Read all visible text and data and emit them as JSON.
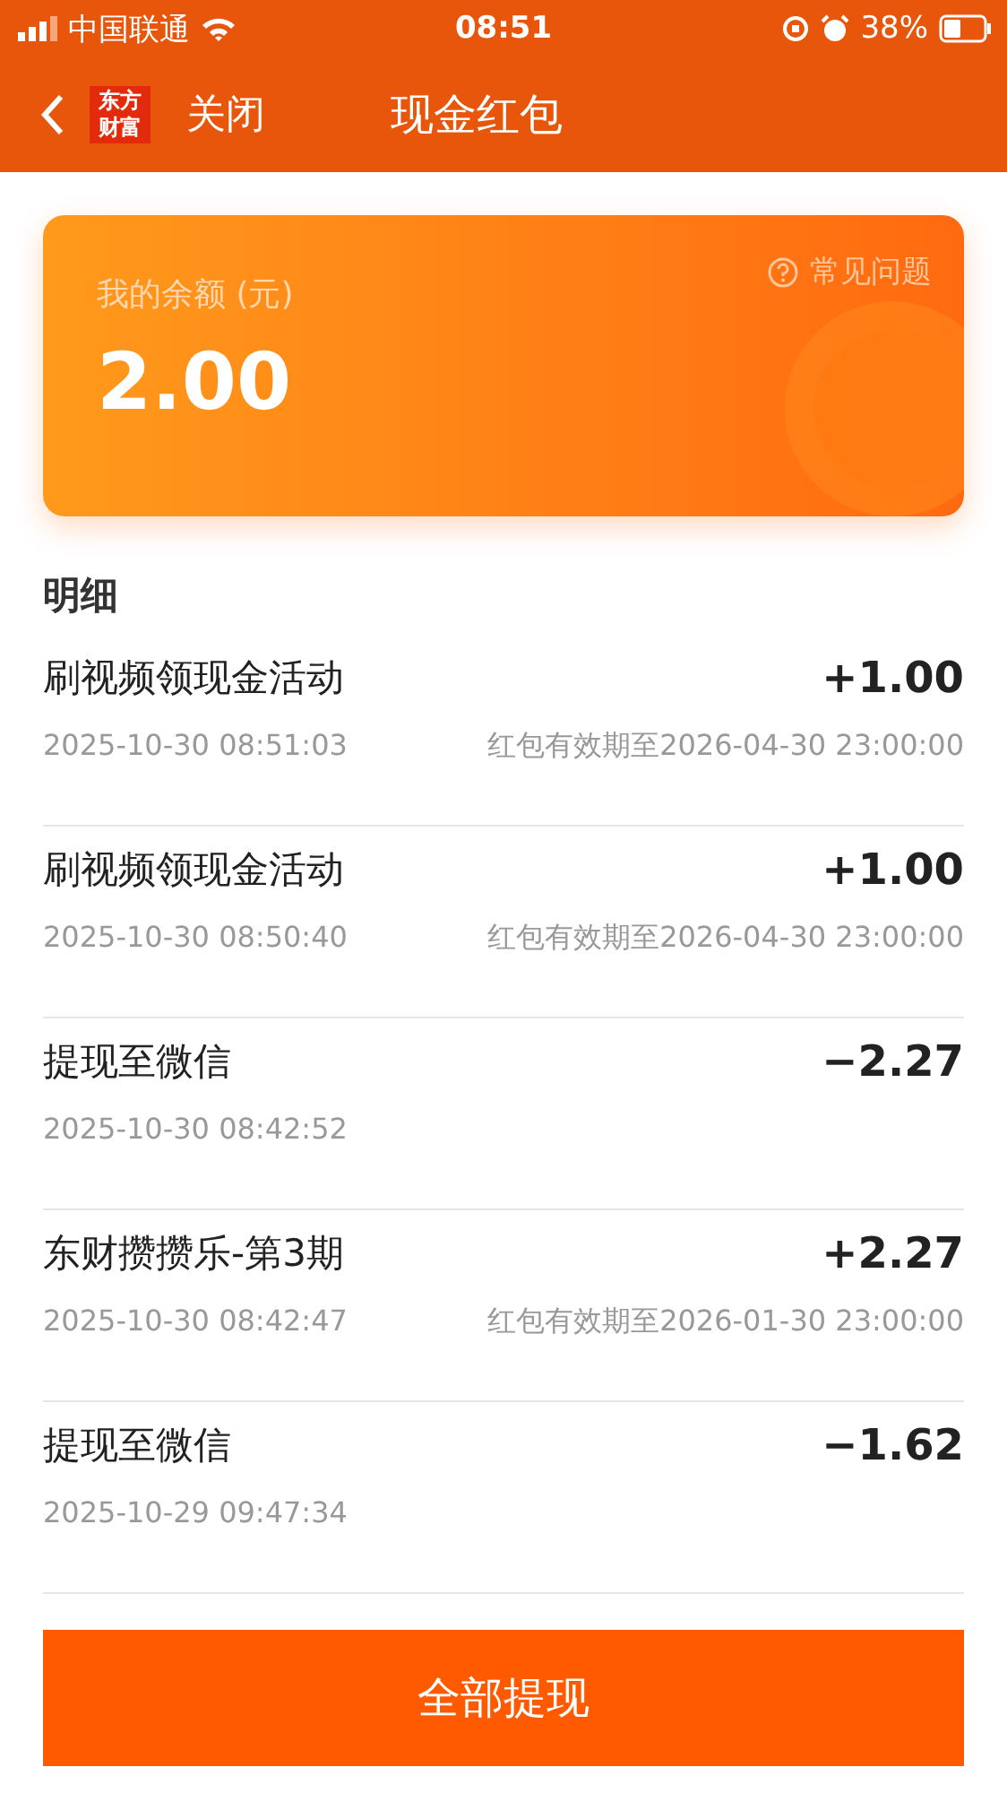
{
  "status_bar": {
    "carrier": "中国联通",
    "time": "08:51",
    "battery": "38%"
  },
  "nav": {
    "logo": "东方财富",
    "close": "关闭",
    "title": "现金红包"
  },
  "balance_card": {
    "label": "我的余额 (元)",
    "amount": "2.00",
    "help": "常见问题"
  },
  "section_title": "明细",
  "records": [
    {
      "title": "刷视频领现金活动",
      "amount": "+1.00",
      "date": "2025-10-30 08:51:03",
      "validity": "红包有效期至2026-04-30 23:00:00"
    },
    {
      "title": "刷视频领现金活动",
      "amount": "+1.00",
      "date": "2025-10-30 08:50:40",
      "validity": "红包有效期至2026-04-30 23:00:00"
    },
    {
      "title": "提现至微信",
      "amount": "−2.27",
      "date": "2025-10-30 08:42:52"
    },
    {
      "title": "东财攒攒乐-第3期",
      "amount": "+2.27",
      "date": "2025-10-30 08:42:47",
      "validity": "红包有效期至2026-01-30 23:00:00"
    },
    {
      "title": "提现至微信",
      "amount": "−1.62",
      "date": "2025-10-29 09:47:34"
    }
  ],
  "withdraw_button": "全部提现"
}
